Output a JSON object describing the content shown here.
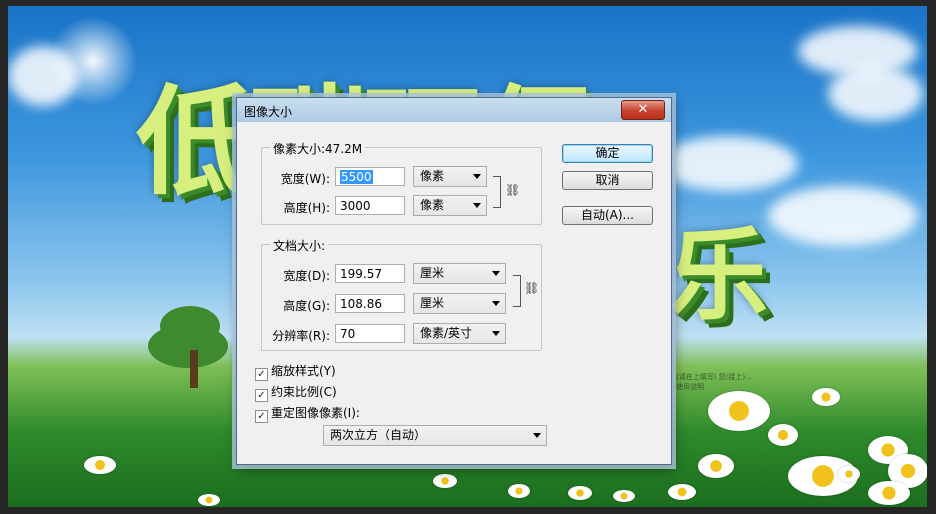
{
  "background": {
    "headline_line1": "低碳环保",
    "headline_line2": "乐",
    "small_text_line1": "(请在上填写) 您(接上)...",
    "small_text_line2": "使用说明"
  },
  "dialog": {
    "title": "图像大小",
    "close_label": "✕",
    "pixel_dimensions": {
      "legend": "像素大小:47.2M",
      "width_label": "宽度(W):",
      "width_value": "5500",
      "width_unit": "像素",
      "height_label": "高度(H):",
      "height_value": "3000",
      "height_unit": "像素"
    },
    "document_size": {
      "legend": "文档大小:",
      "width_label": "宽度(D):",
      "width_value": "199.57",
      "width_unit": "厘米",
      "height_label": "高度(G):",
      "height_value": "108.86",
      "height_unit": "厘米",
      "resolution_label": "分辨率(R):",
      "resolution_value": "70",
      "resolution_unit": "像素/英寸"
    },
    "options": {
      "scale_styles": "缩放样式(Y)",
      "constrain": "约束比例(C)",
      "resample": "重定图像像素(I):",
      "resample_method": "两次立方（自动）"
    },
    "buttons": {
      "ok": "确定",
      "cancel": "取消",
      "auto": "自动(A)..."
    }
  }
}
